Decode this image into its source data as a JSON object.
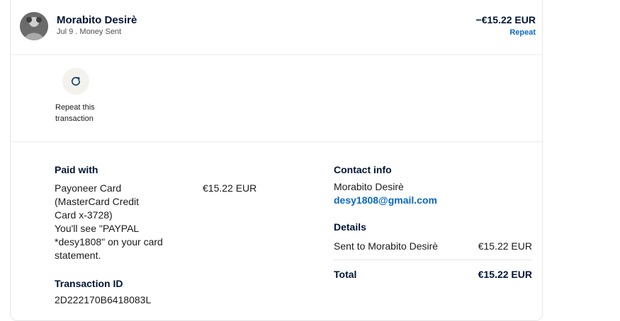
{
  "header": {
    "name": "Morabito Desirè",
    "meta": "Jul 9 . Money Sent",
    "amount": "−€15.22 EUR",
    "repeat_link": "Repeat",
    "avatar_icon": "user-avatar-icon"
  },
  "actions": {
    "repeat_icon": "refresh-icon",
    "repeat_label_line1": "Repeat this",
    "repeat_label_line2": "transaction"
  },
  "paid_with": {
    "title": "Paid with",
    "lines": [
      "Payoneer Card",
      "(MasterCard Credit",
      "Card x-3728)",
      "You'll see \"PAYPAL",
      "*desy1808\" on your card",
      "statement."
    ],
    "amount": "€15.22 EUR"
  },
  "transaction": {
    "title": "Transaction ID",
    "id": "2D222170B6418083L"
  },
  "contact": {
    "title": "Contact info",
    "name": "Morabito Desirè",
    "email": "desy1808@gmail.com"
  },
  "details": {
    "title": "Details",
    "sent_label": "Sent to Morabito Desirè",
    "sent_amount": "€15.22 EUR",
    "total_label": "Total",
    "total_amount": "€15.22 EUR"
  },
  "colors": {
    "link": "#0a68c3",
    "text": "#001435"
  }
}
